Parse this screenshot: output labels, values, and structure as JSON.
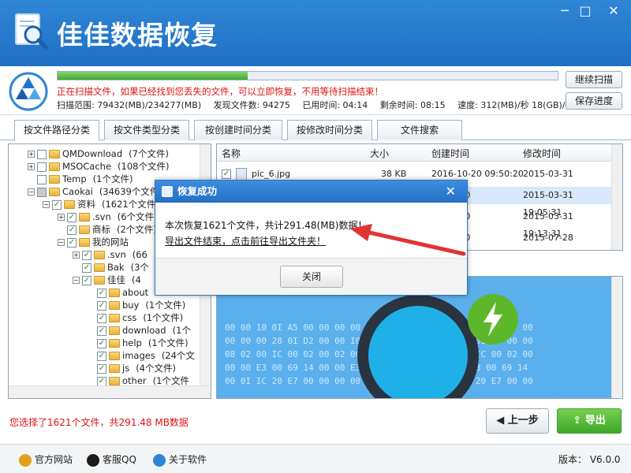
{
  "app": {
    "title": "佳佳数据恢复"
  },
  "window": {
    "min": "─",
    "max": "□",
    "close": "✕"
  },
  "scan": {
    "progress": 0.38,
    "message": "正在扫描文件，如果已经找到您丢失的文件，可以立即恢复，不用等待扫描结束！",
    "range": "扫描范围: 79432(MB)/234277(MB)",
    "found": "发现文件数: 94275",
    "elapsed": "已用时间: 04:14",
    "remaining": "剩余时间: 08:15",
    "speed": "速度: 312(MB)/秒  18(GB)/分",
    "continue_btn": "继续扫描",
    "save_btn": "保存进度"
  },
  "tabs": [
    "按文件路径分类",
    "按文件类型分类",
    "按创建时间分类",
    "按修改时间分类",
    "文件搜索"
  ],
  "tree": [
    {
      "label": "QMDownload",
      "count": "(7个文件)",
      "indent": 0,
      "toggle": "+",
      "check": "none"
    },
    {
      "label": "MSOCache",
      "count": "(108个文件)",
      "indent": 0,
      "toggle": "+",
      "check": "none"
    },
    {
      "label": "Temp",
      "count": "(1个文件)",
      "indent": 0,
      "toggle": "",
      "check": "none"
    },
    {
      "label": "Caokai",
      "count": "(34639个文件)",
      "indent": 0,
      "toggle": "−",
      "check": "part"
    },
    {
      "label": "资料",
      "count": "(1621个文件)",
      "indent": 1,
      "toggle": "−",
      "check": "checked"
    },
    {
      "label": ".svn",
      "count": "(6个文件)",
      "indent": 2,
      "toggle": "+",
      "check": "checked"
    },
    {
      "label": "商标",
      "count": "(2个文件)",
      "indent": 2,
      "toggle": "",
      "check": "checked"
    },
    {
      "label": "我的网站",
      "count": "",
      "indent": 2,
      "toggle": "−",
      "check": "checked"
    },
    {
      "label": ".svn",
      "count": "(66",
      "indent": 3,
      "toggle": "+",
      "check": "checked"
    },
    {
      "label": "Bak",
      "count": "(3个",
      "indent": 3,
      "toggle": "",
      "check": "checked"
    },
    {
      "label": "佳佳",
      "count": "(4",
      "indent": 3,
      "toggle": "−",
      "check": "checked"
    },
    {
      "label": "about",
      "count": "",
      "indent": 4,
      "toggle": "",
      "check": "checked"
    },
    {
      "label": "buy",
      "count": "(1个文件)",
      "indent": 4,
      "toggle": "",
      "check": "checked"
    },
    {
      "label": "css",
      "count": "(1个文件)",
      "indent": 4,
      "toggle": "",
      "check": "checked"
    },
    {
      "label": "download",
      "count": "(1个",
      "indent": 4,
      "toggle": "",
      "check": "checked"
    },
    {
      "label": "help",
      "count": "(1个文件)",
      "indent": 4,
      "toggle": "",
      "check": "checked"
    },
    {
      "label": "images",
      "count": "(24个文",
      "indent": 4,
      "toggle": "",
      "check": "checked"
    },
    {
      "label": "js",
      "count": "(4个文件)",
      "indent": 4,
      "toggle": "",
      "check": "checked"
    },
    {
      "label": "other",
      "count": "(1个文件",
      "indent": 4,
      "toggle": "",
      "check": "checked"
    }
  ],
  "files": {
    "headers": [
      "名称",
      "大小",
      "创建时间",
      "修改时间"
    ],
    "rows": [
      {
        "name": "pic_6.jpg",
        "size": "38 KB",
        "created": "2016-10-20  09:50:20",
        "modified": "2015-03-31  19:05:31",
        "selected": false
      },
      {
        "name": "",
        "size": "",
        "created": "09:50:20",
        "modified": "2015-03-31  19:05:31",
        "selected": true
      },
      {
        "name": "",
        "size": "",
        "created": "09:50:20",
        "modified": "2015-03-31  19:13:31",
        "selected": false
      },
      {
        "name": "",
        "size": "",
        "created": "09:50:20",
        "modified": "2015-07-28  23:40:28",
        "selected": false
      }
    ]
  },
  "hex": [
    "00 00 10 0I A5 00 00 00 00 28 0I D2 00 00 00 00 10 0I A5 00",
    "00 00 00 28 0I D2 00 00 I0 00 00 00 00 00 00 00 0I D2 00 00",
    "08 02 00 IC 00 02 00 02 00 00 00 00 00 00 02 00 IC 00 02 00",
    "00 00 E3 00 69 14 00 00 E3 00 6 00 69 14 00 00 E3 00 69 14",
    "00 0I IC 20 E7 00 00 00 00 IC 20 E7 00 00 0I IC 20 E7 00 00"
  ],
  "footer": {
    "selection": "您选择了1621个文件，共291.48 MB数据",
    "back_btn": "上一步",
    "export_btn": "导出"
  },
  "statusbar": {
    "site": "官方网站",
    "qq": "客服QQ",
    "about": "关于软件",
    "version": "版本： V6.0.0"
  },
  "dialog": {
    "title": "恢复成功",
    "message": "本次恢复1621个文件，共计291.48(MB)数据！",
    "link": "导出文件结束，点击前往导出文件夹！",
    "ok_btn": "关闭",
    "close": "✕"
  },
  "colors": {
    "accent": "#2274c6",
    "warning": "#e01010",
    "success": "#3ea62a"
  }
}
